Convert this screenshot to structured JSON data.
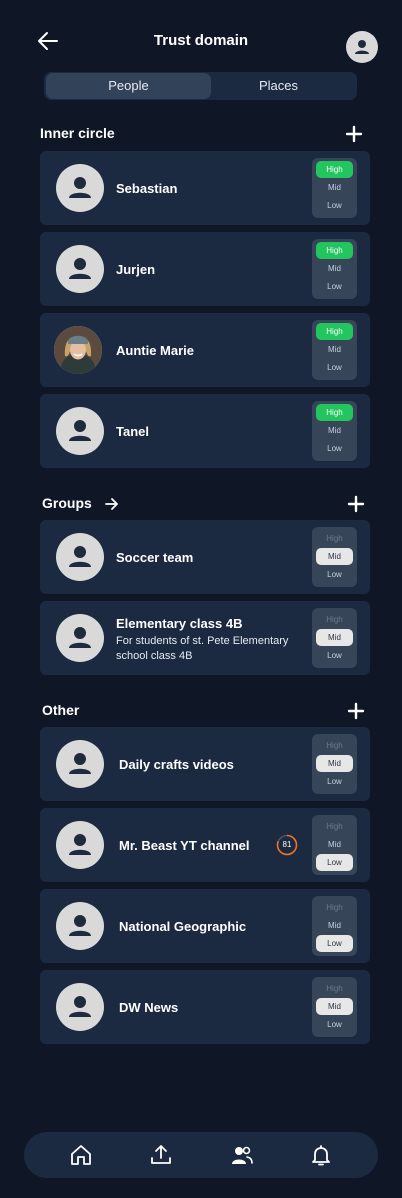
{
  "header": {
    "title": "Trust domain"
  },
  "tabs": [
    {
      "label": "People"
    },
    {
      "label": "Places"
    }
  ],
  "levels": {
    "high": "High",
    "mid": "Mid",
    "low": "Low"
  },
  "sections": {
    "inner": {
      "title": "Inner circle"
    },
    "groups": {
      "title": "Groups"
    },
    "other": {
      "title": "Other"
    }
  },
  "inner_circle": [
    {
      "name": "Sebastian",
      "trust": "high"
    },
    {
      "name": "Jurjen",
      "trust": "high"
    },
    {
      "name": "Auntie Marie",
      "trust": "high",
      "photo": true
    },
    {
      "name": "Tanel",
      "trust": "high"
    }
  ],
  "groups": [
    {
      "name": "Soccer team",
      "trust": "mid"
    },
    {
      "name": "Elementary class 4B",
      "description": "For students of st. Pete Elementary school class 4B",
      "trust": "mid"
    }
  ],
  "other": [
    {
      "name": "Daily crafts videos",
      "trust": "mid"
    },
    {
      "name": "Mr. Beast YT channel",
      "trust": "low",
      "score": "81"
    },
    {
      "name": "National Geographic",
      "trust": "low"
    },
    {
      "name": "DW News",
      "trust": "mid"
    }
  ],
  "colors": {
    "background": "#0f1727",
    "card": "#1b2a41",
    "high": "#22c55e",
    "score": "#f97316"
  },
  "nav": {
    "icons": [
      "home-icon",
      "upload-icon",
      "people-icon",
      "bell-icon"
    ]
  }
}
